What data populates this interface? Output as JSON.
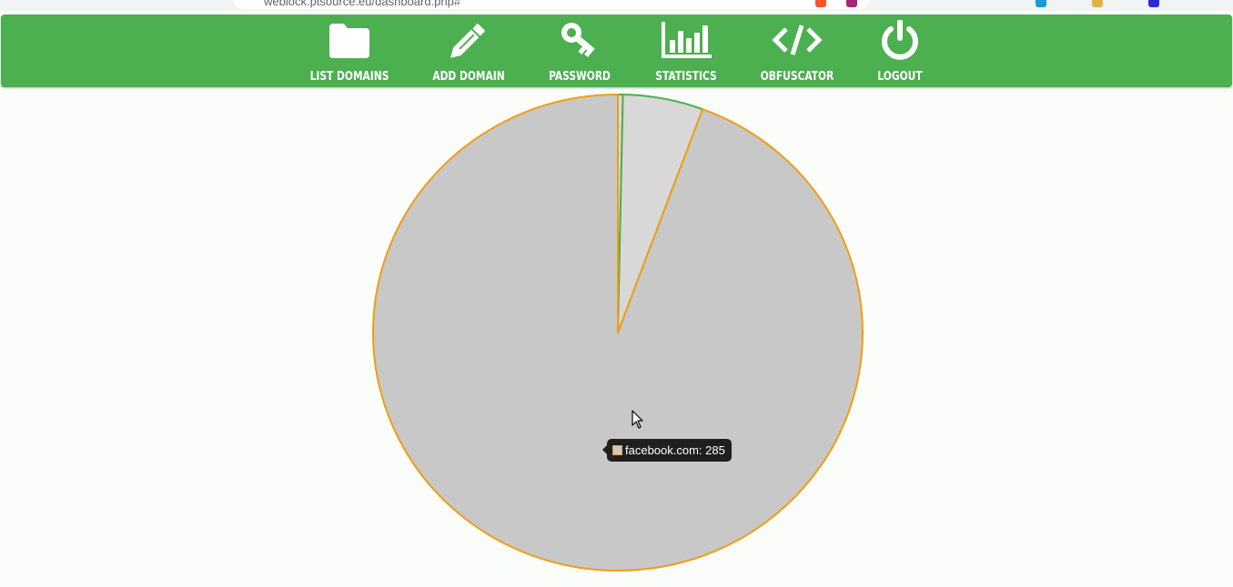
{
  "browser": {
    "url": "weblock.ptsource.eu/dashboard.php#"
  },
  "nav": {
    "items": [
      {
        "label": "LIST DOMAINS",
        "icon": "folder-icon"
      },
      {
        "label": "ADD DOMAIN",
        "icon": "pencil-icon"
      },
      {
        "label": "PASSWORD",
        "icon": "key-icon"
      },
      {
        "label": "STATISTICS",
        "icon": "bar-chart-icon"
      },
      {
        "label": "OBFUSCATOR",
        "icon": "code-icon"
      },
      {
        "label": "LOGOUT",
        "icon": "power-icon"
      }
    ]
  },
  "colors": {
    "nav_bg": "#4caf50",
    "slice_fill": "#c8c8c8",
    "slice_fill_small": "#d8d8d8",
    "border_orange": "#f39c12",
    "border_green": "#4caf50"
  },
  "chart_data": {
    "type": "pie",
    "slices": [
      {
        "label": "",
        "value": 1,
        "fill": "#d8d8d8",
        "stroke": "#4caf50"
      },
      {
        "label": "",
        "value": 16,
        "fill": "#d8d8d8",
        "stroke": "#4caf50"
      },
      {
        "label": "facebook.com",
        "value": 285,
        "fill": "#c8c8c8",
        "stroke": "#f39c12"
      }
    ],
    "tooltip": {
      "label": "facebook.com",
      "value": 285,
      "text": "facebook.com: 285"
    }
  }
}
